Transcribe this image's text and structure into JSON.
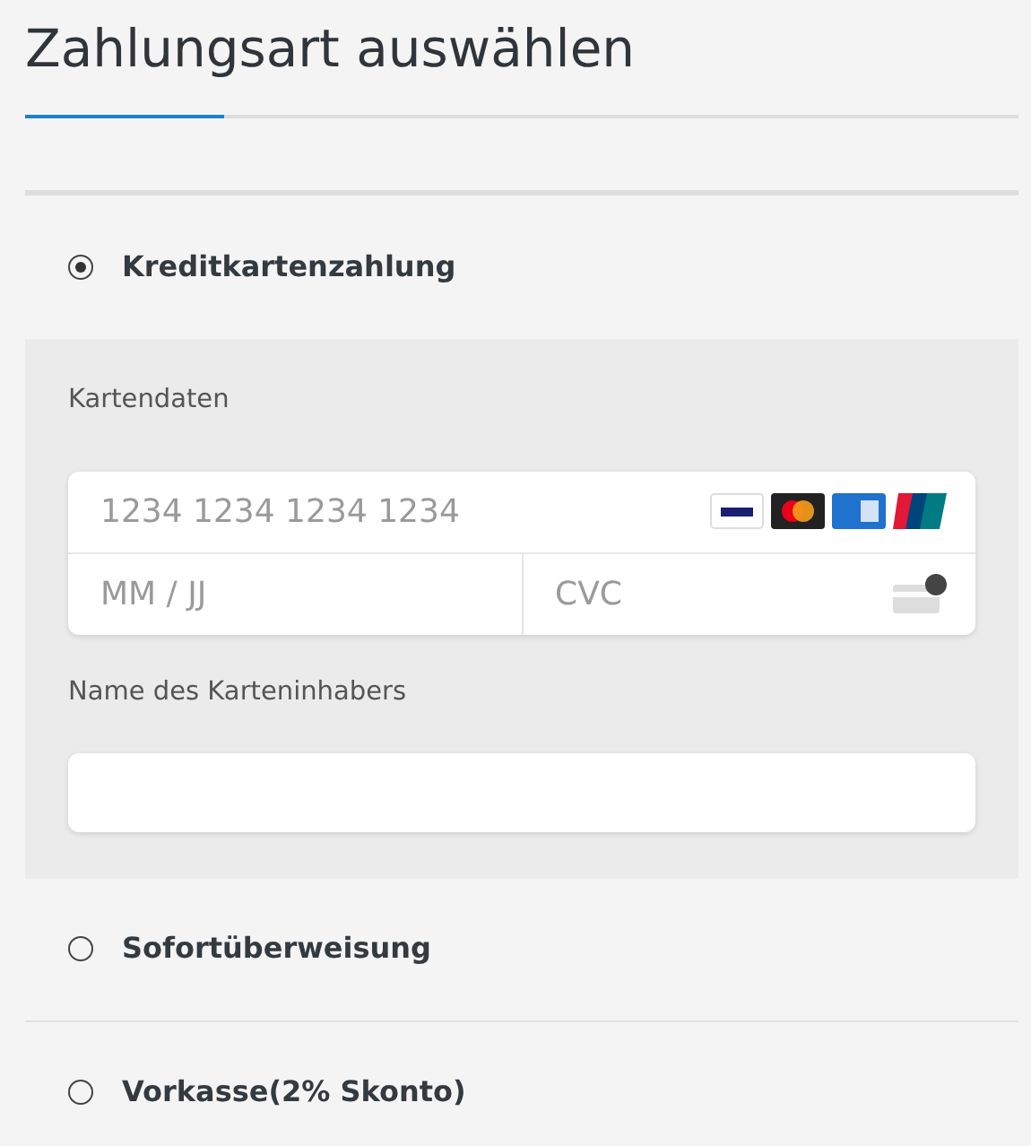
{
  "title": "Zahlungsart auswählen",
  "methods": [
    {
      "label": "Kreditkartenzahlung",
      "selected": true
    },
    {
      "label": "Sofortüberweisung",
      "selected": false
    },
    {
      "label": "Vorkasse(2% Skonto)",
      "selected": false
    }
  ],
  "card_form": {
    "section_label": "Kartendaten",
    "card_number": {
      "placeholder": "1234 1234 1234 1234"
    },
    "expiry": {
      "placeholder": "MM / JJ"
    },
    "cvc": {
      "placeholder": "CVC"
    },
    "holder_label": "Name des Karteninhabers"
  }
}
